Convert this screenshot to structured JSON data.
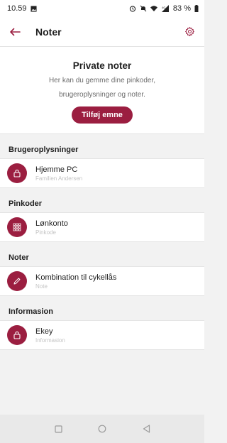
{
  "status_bar": {
    "time": "10.59",
    "battery": "83 %",
    "network": "4G"
  },
  "app_bar": {
    "title": "Noter"
  },
  "hero": {
    "title": "Private noter",
    "description_line1": "Her kan du gemme dine pinkoder,",
    "description_line2": "brugeroplysninger og noter.",
    "add_button": "Tilføj emne"
  },
  "sections": [
    {
      "header": "Brugeroplysninger",
      "item": {
        "title": "Hjemme PC",
        "subtitle": "Familien Andersen",
        "icon": "lock-icon"
      }
    },
    {
      "header": "Pinkoder",
      "item": {
        "title": "Lønkonto",
        "subtitle": "Pinkode",
        "icon": "keypad-icon"
      }
    },
    {
      "header": "Noter",
      "item": {
        "title": "Kombination til cykellås",
        "subtitle": "Note",
        "icon": "pencil-icon"
      }
    },
    {
      "header": "Informasion",
      "item": {
        "title": "Ekey",
        "subtitle": "Informasion",
        "icon": "lock-icon"
      }
    }
  ],
  "colors": {
    "accent": "#9b1e40",
    "background": "#f2f2f2",
    "surface": "#ffffff"
  }
}
